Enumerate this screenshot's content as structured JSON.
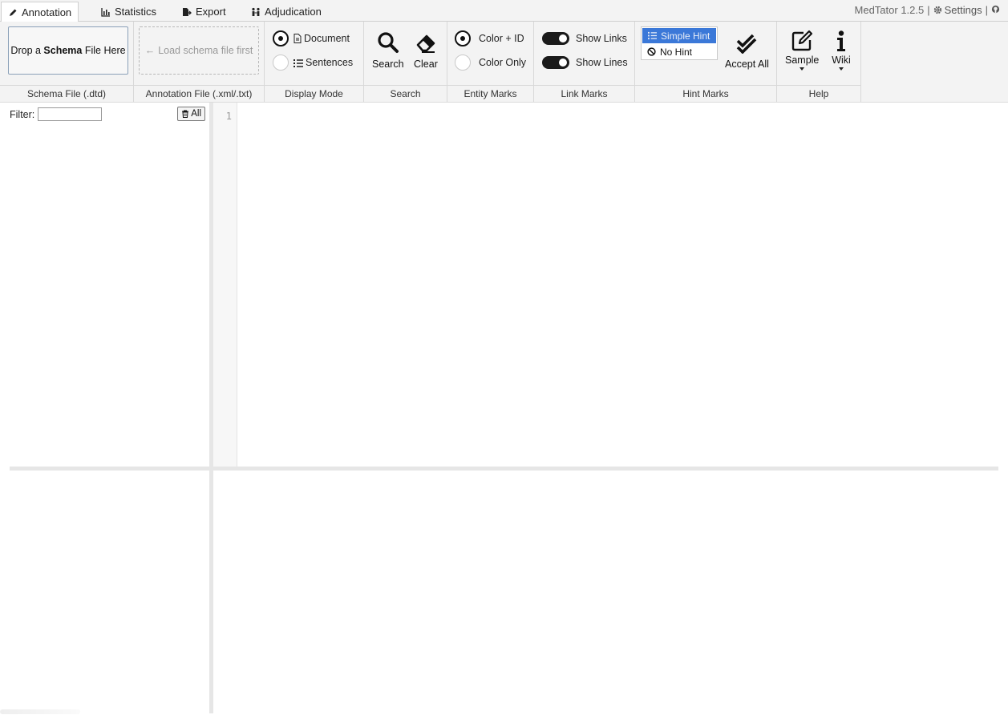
{
  "tabs": [
    {
      "label": "Annotation",
      "icon": "pencil-icon"
    },
    {
      "label": "Statistics",
      "icon": "bar-chart-icon"
    },
    {
      "label": "Export",
      "icon": "file-export-icon"
    },
    {
      "label": "Adjudication",
      "icon": "people-compare-icon"
    }
  ],
  "app": {
    "version": "MedTator 1.2.5",
    "sep": "|",
    "settings_label": "Settings"
  },
  "schema": {
    "drop_prefix": "Drop a ",
    "drop_bold": "Schema",
    "drop_suffix": " File Here",
    "group_label": "Schema File (.dtd)"
  },
  "annotation_file": {
    "load_label": "Load schema file first",
    "group_label": "Annotation File (.xml/.txt)"
  },
  "display_mode": {
    "group_label": "Display Mode",
    "options": [
      "Document",
      "Sentences"
    ],
    "selected": "Document"
  },
  "search_group": {
    "group_label": "Search",
    "search_label": "Search",
    "clear_label": "Clear"
  },
  "entity_marks": {
    "group_label": "Entity Marks",
    "options": [
      "Color + ID",
      "Color Only"
    ],
    "selected": "Color + ID"
  },
  "link_marks": {
    "group_label": "Link Marks",
    "show_links": "Show Links",
    "show_lines": "Show Lines",
    "links_on": true,
    "lines_on": true
  },
  "hint_marks": {
    "group_label": "Hint Marks",
    "options": [
      "Simple Hint",
      "No Hint"
    ],
    "selected": "Simple Hint",
    "accept_all": "Accept All"
  },
  "help": {
    "group_label": "Help",
    "sample_label": "Sample",
    "wiki_label": "Wiki"
  },
  "filter": {
    "label": "Filter:",
    "value": "",
    "all_label": "All"
  },
  "editor": {
    "line_numbers": [
      "1"
    ]
  },
  "colors": {
    "accent": "#3b78d8",
    "toolbar_bg": "#f3f3f3"
  }
}
